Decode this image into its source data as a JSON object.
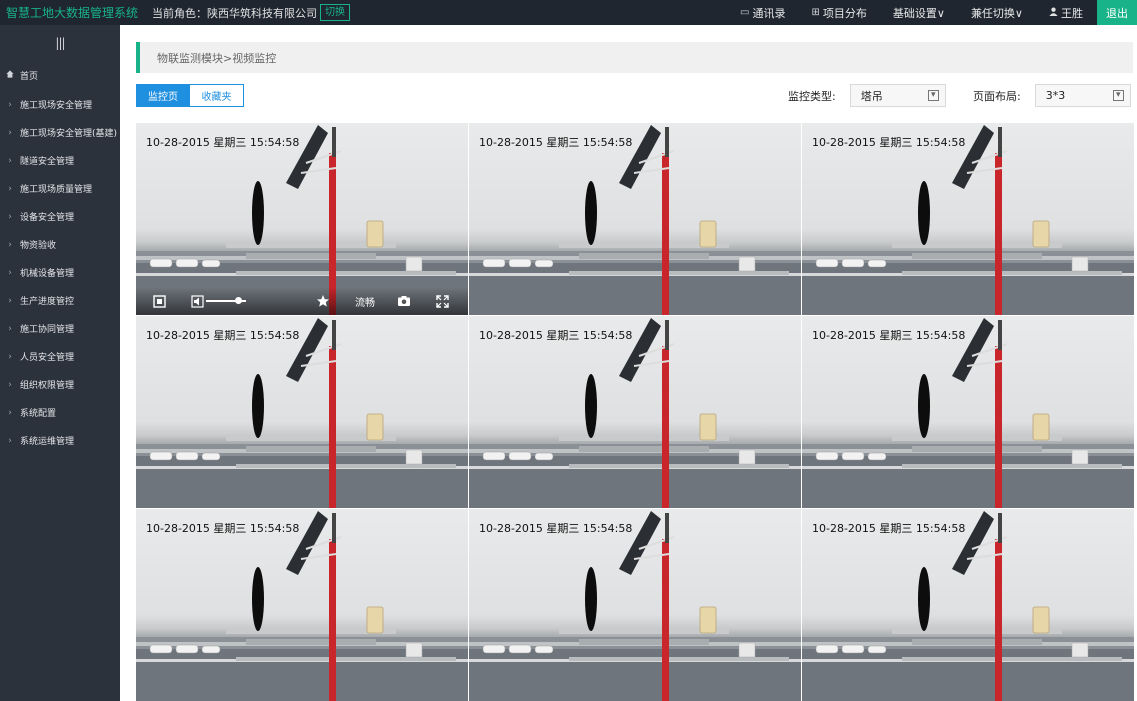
{
  "header": {
    "app_title": "智慧工地大数据管理系统",
    "role_label": "当前角色：陕西华筑科技有限公司",
    "switch_label": "切换",
    "nav": [
      {
        "icon": "chat-icon",
        "label": "通讯录"
      },
      {
        "icon": "sitemap-icon",
        "label": "项目分布"
      },
      {
        "icon": "",
        "label": "基础设置∨"
      },
      {
        "icon": "",
        "label": "兼任切换∨"
      },
      {
        "icon": "user-icon",
        "label": "王胜"
      }
    ],
    "logout_label": "退出"
  },
  "sidebar": {
    "toggle_icon": "menu-icon",
    "items": [
      {
        "label": "首页",
        "icon": "home-icon"
      },
      {
        "label": "施工现场安全管理"
      },
      {
        "label": "施工现场安全管理(基建)"
      },
      {
        "label": "隧道安全管理"
      },
      {
        "label": "施工现场质量管理"
      },
      {
        "label": "设备安全管理"
      },
      {
        "label": "物资验收"
      },
      {
        "label": "机械设备管理"
      },
      {
        "label": "生产进度管控"
      },
      {
        "label": "施工协同管理"
      },
      {
        "label": "人员安全管理"
      },
      {
        "label": "组织权限管理"
      },
      {
        "label": "系统配置"
      },
      {
        "label": "系统运维管理"
      }
    ]
  },
  "main": {
    "breadcrumb": "物联监测模块>视频监控",
    "tabs": [
      {
        "label": "监控页",
        "active": true
      },
      {
        "label": "收藏夹",
        "active": false
      }
    ],
    "filters": {
      "monitor_type_label": "监控类型:",
      "monitor_type_value": "塔吊",
      "layout_label": "页面布局:",
      "layout_value": "3*3"
    },
    "video_timestamp": "10-28-2015 星期三 15:54:58",
    "video_count": 9,
    "player_controls": {
      "quality_label": "流畅",
      "icons": [
        "fullscreen-exit-icon",
        "volume-icon",
        "star-icon",
        "camera-icon",
        "expand-icon"
      ],
      "volume_level": 0.8
    }
  },
  "colors": {
    "accent": "#19b38a",
    "tab_blue": "#1f8fe0",
    "topbar_bg": "#1f2630",
    "sidebar_bg": "#2c323c",
    "pole_red": "#c8262b"
  }
}
